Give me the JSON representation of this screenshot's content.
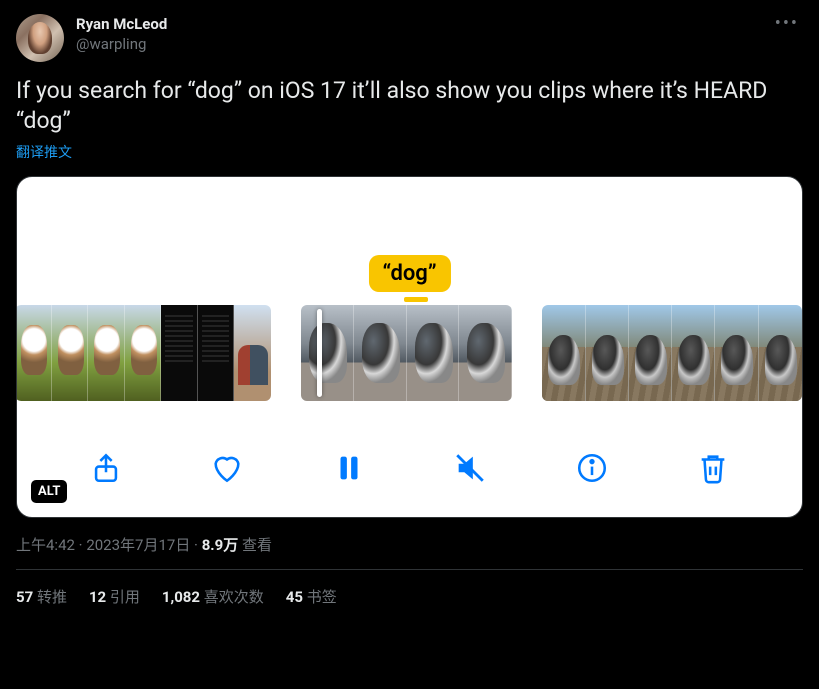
{
  "author": {
    "display_name": "Ryan McLeod",
    "handle": "@warpling"
  },
  "more_label": "•••",
  "body": "If you search for “dog” on iOS 17 it’ll also show you clips where it’s HEARD “dog”",
  "translate_label": "翻译推文",
  "media": {
    "bubble": "“dog”",
    "alt_badge": "ALT"
  },
  "meta": {
    "time": "上午4:42",
    "sep1": " · ",
    "date": "2023年7月17日",
    "sep2": " · ",
    "views_value": "8.9万",
    "views_label": " 查看"
  },
  "stats": {
    "retweets_value": "57",
    "retweets_label": " 转推",
    "quotes_value": "12",
    "quotes_label": " 引用",
    "likes_value": "1,082",
    "likes_label": " 喜欢次数",
    "bookmarks_value": "45",
    "bookmarks_label": " 书签"
  }
}
